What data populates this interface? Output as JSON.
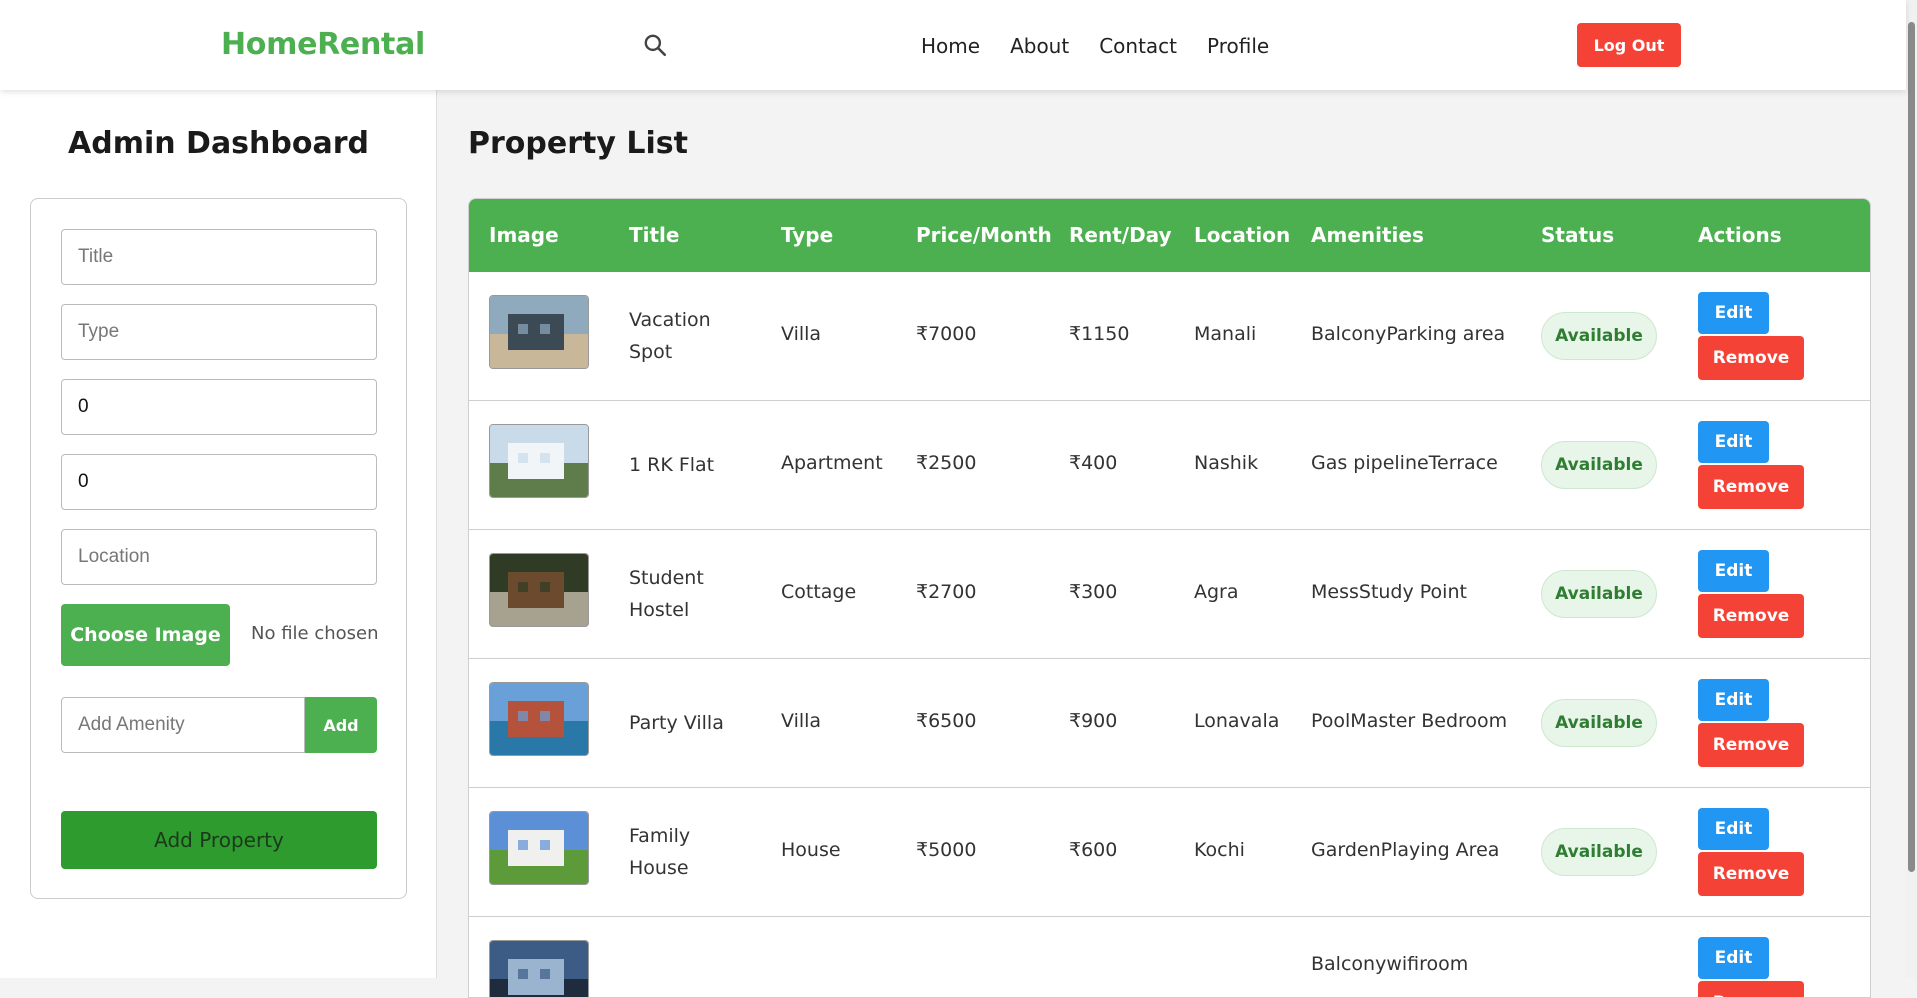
{
  "nav": {
    "brand": "HomeRental",
    "links": [
      "Home",
      "About",
      "Contact",
      "Profile"
    ],
    "logout_label": "Log Out"
  },
  "sidebar": {
    "title": "Admin Dashboard",
    "fields": {
      "title_placeholder": "Title",
      "type_placeholder": "Type",
      "price_value": "0",
      "rent_value": "0",
      "location_placeholder": "Location"
    },
    "choose_image_label": "Choose Image",
    "no_file_text": "No file chosen",
    "amenity_placeholder": "Add Amenity",
    "amenity_add_label": "Add",
    "add_property_label": "Add Property"
  },
  "main": {
    "title": "Property List",
    "columns": [
      "Image",
      "Title",
      "Type",
      "Price/Month",
      "Rent/Day",
      "Location",
      "Amenities",
      "Status",
      "Actions"
    ],
    "rows": [
      {
        "title": "Vacation Spot",
        "title_lines": [
          "Vacation",
          "Spot"
        ],
        "type": "Villa",
        "price": "₹7000",
        "rent": "₹1150",
        "location": "Manali",
        "amenities": "BalconyParking area",
        "status": "Available",
        "image": "lake-villa-photo"
      },
      {
        "title": "1 RK Flat",
        "title_lines": [
          "1 RK Flat"
        ],
        "type": "Apartment",
        "price": "₹2500",
        "rent": "₹400",
        "location": "Nashik",
        "amenities": "Gas pipelineTerrace",
        "status": "Available",
        "image": "white-apartment-photo"
      },
      {
        "title": "Student Hostel",
        "title_lines": [
          "Student",
          "Hostel"
        ],
        "type": "Cottage",
        "price": "₹2700",
        "rent": "₹300",
        "location": "Agra",
        "amenities": "MessStudy Point",
        "status": "Available",
        "image": "cottage-photo"
      },
      {
        "title": "Party Villa",
        "title_lines": [
          "Party Villa"
        ],
        "type": "Villa",
        "price": "₹6500",
        "rent": "₹900",
        "location": "Lonavala",
        "amenities": "PoolMaster Bedroom",
        "status": "Available",
        "image": "pool-villa-photo"
      },
      {
        "title": "Family House",
        "title_lines": [
          "Family",
          "House"
        ],
        "type": "House",
        "price": "₹5000",
        "rent": "₹600",
        "location": "Kochi",
        "amenities": "GardenPlaying Area",
        "status": "Available",
        "image": "family-house-photo"
      },
      {
        "title": "",
        "title_lines": [
          ""
        ],
        "type": "",
        "price": "",
        "rent": "",
        "location": "",
        "amenities": "Balconywifiroom",
        "status": "",
        "image": "building-photo"
      }
    ],
    "edit_label": "Edit",
    "remove_label": "Remove"
  },
  "colors": {
    "brand_green": "#4caf50",
    "danger_red": "#f44336",
    "edit_blue": "#2196f3",
    "badge_bg": "#e8f5e9",
    "badge_text": "#2e7d32"
  }
}
